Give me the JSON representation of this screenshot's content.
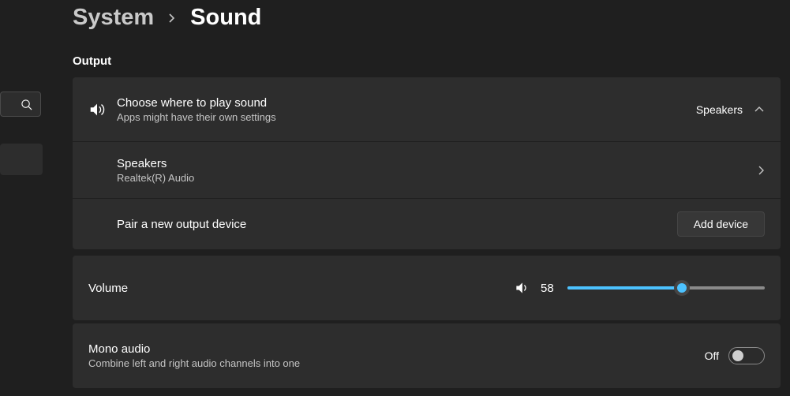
{
  "breadcrumb": {
    "parent": "System",
    "current": "Sound"
  },
  "section": {
    "output_title": "Output"
  },
  "output_selector": {
    "title": "Choose where to play sound",
    "subtitle": "Apps might have their own settings",
    "current": "Speakers"
  },
  "device": {
    "name": "Speakers",
    "driver": "Realtek(R) Audio"
  },
  "pair": {
    "label": "Pair a new output device",
    "button": "Add device"
  },
  "volume": {
    "label": "Volume",
    "value": "58",
    "percent": 58
  },
  "mono": {
    "title": "Mono audio",
    "subtitle": "Combine left and right audio channels into one",
    "state": "Off"
  }
}
